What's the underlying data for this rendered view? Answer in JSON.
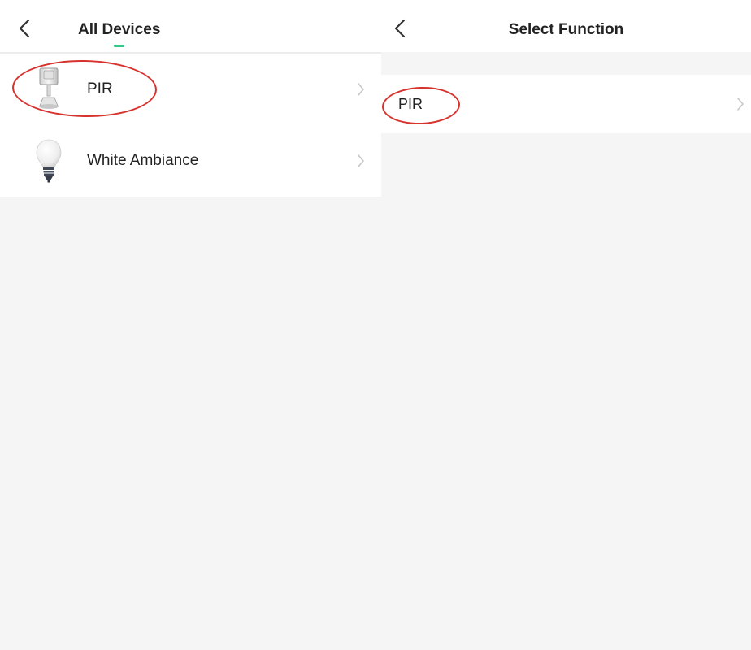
{
  "left_screen": {
    "title": "All Devices",
    "devices": [
      {
        "label": "PIR",
        "icon": "pir-sensor-icon",
        "highlighted": true
      },
      {
        "label": "White Ambiance",
        "icon": "light-bulb-icon",
        "highlighted": false
      }
    ]
  },
  "right_screen": {
    "title": "Select Function",
    "functions": [
      {
        "label": "PIR",
        "highlighted": true
      }
    ]
  },
  "colors": {
    "highlight_ellipse": "#d6332e",
    "active_indicator": "#37c58a",
    "background": "#f5f5f5",
    "row_background": "#ffffff"
  }
}
